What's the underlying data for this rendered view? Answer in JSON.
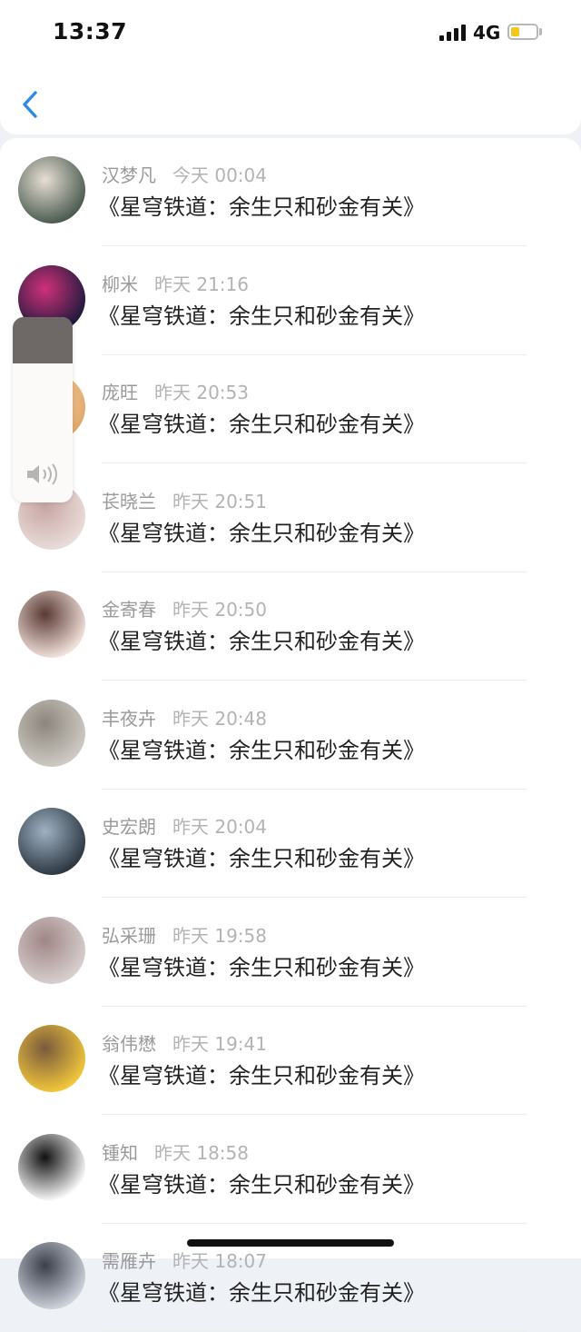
{
  "status_bar": {
    "time": "13:37",
    "network": "4G",
    "battery_level": 0.25
  },
  "nav": {
    "back_icon": "chevron-left-icon"
  },
  "volume_hud": {
    "level": 0.25,
    "icon": "speaker-icon"
  },
  "rows": [
    {
      "name": "汉梦凡",
      "time": "今天 00:04",
      "message": "《星穹铁道：余生只和砂金有关》",
      "avatar_colors": [
        "#4a5a4f",
        "#e7dfd5"
      ]
    },
    {
      "name": "柳米",
      "time": "昨天 21:16",
      "message": "《星穹铁道：余生只和砂金有关》",
      "avatar_colors": [
        "#1e1a3c",
        "#d0307a"
      ]
    },
    {
      "name": "庞旺",
      "time": "昨天 20:53",
      "message": "《星穹铁道：余生只和砂金有关》",
      "avatar_colors": [
        "#e0a86a",
        "#f5d3b0"
      ]
    },
    {
      "name": "苌晓兰",
      "time": "昨天 20:51",
      "message": "《星穹铁道：余生只和砂金有关》",
      "avatar_colors": [
        "#e9dcd9",
        "#c7a6a3"
      ]
    },
    {
      "name": "金寄春",
      "time": "昨天 20:50",
      "message": "《星穹铁道：余生只和砂金有关》",
      "avatar_colors": [
        "#f3e2dc",
        "#5a3a34"
      ]
    },
    {
      "name": "丰夜卉",
      "time": "昨天 20:48",
      "message": "《星穹铁道：余生只和砂金有关》",
      "avatar_colors": [
        "#cfcbc4",
        "#8c857d"
      ]
    },
    {
      "name": "史宏朗",
      "time": "昨天 20:04",
      "message": "《星穹铁道：余生只和砂金有关》",
      "avatar_colors": [
        "#2b3640",
        "#9fb2c4"
      ]
    },
    {
      "name": "弘采珊",
      "time": "昨天 19:58",
      "message": "《星穹铁道：余生只和砂金有关》",
      "avatar_colors": [
        "#d8cfcf",
        "#a08686"
      ]
    },
    {
      "name": "翁伟懋",
      "time": "昨天 19:41",
      "message": "《星穹铁道：余生只和砂金有关》",
      "avatar_colors": [
        "#f2c73b",
        "#7a5a3c"
      ]
    },
    {
      "name": "锺知",
      "time": "昨天 18:58",
      "message": "《星穹铁道：余生只和砂金有关》",
      "avatar_colors": [
        "#ffffff",
        "#111111"
      ]
    },
    {
      "name": "需雁卉",
      "time": "昨天 18:07",
      "message": "《星穹铁道：余生只和砂金有关》",
      "avatar_colors": [
        "#cfd3dc",
        "#3a3f4a"
      ]
    }
  ]
}
